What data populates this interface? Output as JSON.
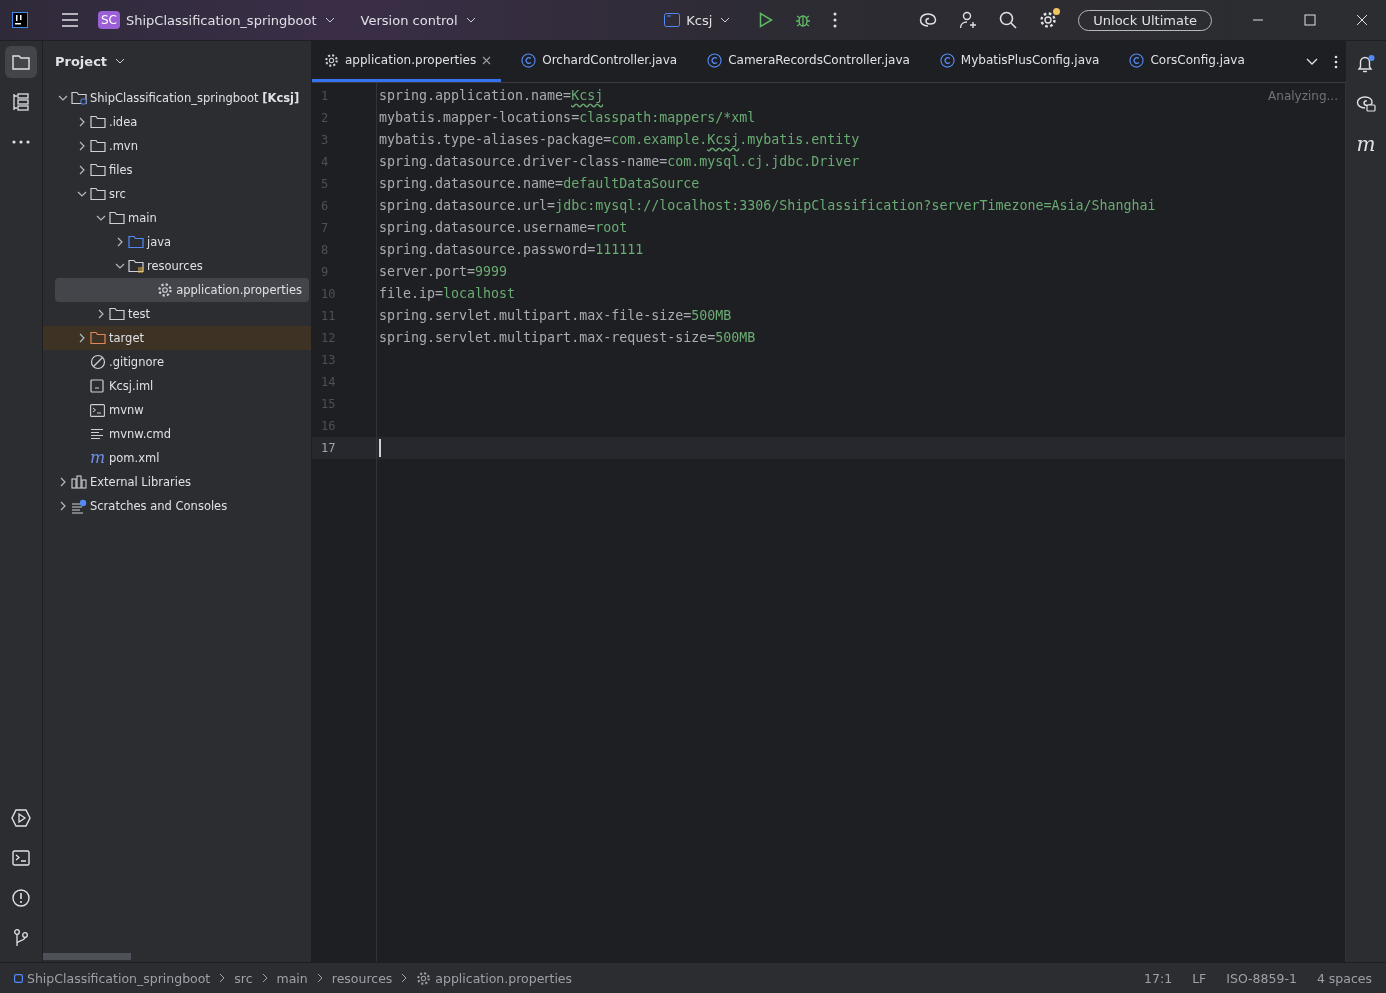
{
  "title_bar": {
    "project_badge": "SC",
    "project_name": "ShipClassification_springboot",
    "vcs": "Version control",
    "run_config": "Kcsj",
    "settings_badge": true,
    "unlock_button": "Unlock Ultimate"
  },
  "left_toolbar": [
    {
      "kind": "project",
      "selected": true
    },
    {
      "kind": "structure",
      "selected": false
    },
    {
      "kind": "more",
      "selected": false
    }
  ],
  "left_toolbar_bottom": [
    {
      "kind": "services"
    },
    {
      "kind": "terminal"
    },
    {
      "kind": "problems"
    },
    {
      "kind": "git"
    }
  ],
  "project_panel": {
    "title": "Project",
    "tree": [
      {
        "kind": "module-root",
        "label": "ShipClassification_springboot **[Kcsj]**",
        "expanded": true,
        "selected": false,
        "children": [
          {
            "kind": "folder",
            "label": ".idea",
            "expanded": false,
            "selected": false
          },
          {
            "kind": "folder",
            "label": ".mvn",
            "expanded": false,
            "selected": false
          },
          {
            "kind": "folder",
            "label": "files",
            "expanded": false,
            "selected": false
          },
          {
            "kind": "folder",
            "label": "src",
            "expanded": true,
            "selected": false,
            "children": [
              {
                "kind": "folder",
                "label": "main",
                "expanded": true,
                "selected": false,
                "children": [
                  {
                    "kind": "source-folder",
                    "label": "java",
                    "expanded": false,
                    "selected": false
                  },
                  {
                    "kind": "resources-folder",
                    "label": "resources",
                    "expanded": true,
                    "selected": false,
                    "children": [
                      {
                        "kind": "settings",
                        "label": "application.properties",
                        "selected": true
                      }
                    ]
                  }
                ]
              },
              {
                "kind": "folder",
                "label": "test",
                "expanded": false,
                "selected": false
              }
            ]
          },
          {
            "kind": "excluded-folder",
            "label": "target",
            "expanded": false,
            "selected": false
          },
          {
            "kind": "ignore",
            "label": ".gitignore",
            "selected": false
          },
          {
            "kind": "module-file",
            "label": "Kcsj.iml",
            "selected": false
          },
          {
            "kind": "script",
            "label": "mvnw",
            "selected": false
          },
          {
            "kind": "text",
            "label": "mvnw.cmd",
            "selected": false
          },
          {
            "kind": "maven",
            "glyph": "m",
            "label": "pom.xml",
            "selected": false
          }
        ]
      },
      {
        "kind": "libraries",
        "label": "External Libraries",
        "expanded": false,
        "selected": false
      },
      {
        "kind": "scratches",
        "label": "Scratches and Consoles",
        "expanded": false,
        "selected": false
      }
    ]
  },
  "tabs": [
    {
      "kind": "settings",
      "label": "application.properties",
      "selected": true
    },
    {
      "kind": "class",
      "label": "OrchardController.java",
      "selected": false
    },
    {
      "kind": "class",
      "label": "CameraRecordsController.java",
      "selected": false
    },
    {
      "kind": "class",
      "label": "MybatisPlusConfig.java",
      "selected": false
    },
    {
      "kind": "class",
      "label": "CorsConfig.java",
      "selected": false
    }
  ],
  "editor": {
    "status": "Analyzing...",
    "lines": [
      {
        "number": "1",
        "key": "spring.application.name=",
        "value": [
          {
            "text": "Kcsj",
            "typo": true
          }
        ],
        "current": false
      },
      {
        "number": "2",
        "key": "mybatis.mapper-locations=",
        "value": [
          {
            "text": "classpath:mappers/*xml",
            "typo": false
          }
        ],
        "current": false
      },
      {
        "number": "3",
        "key": "mybatis.type-aliases-package=",
        "value": [
          {
            "text": "com.example.",
            "typo": false
          },
          {
            "text": "Kcsj",
            "typo": true
          },
          {
            "text": ".mybatis.entity",
            "typo": false
          }
        ],
        "current": false
      },
      {
        "number": "4",
        "key": "spring.datasource.driver-class-name=",
        "value": [
          {
            "text": "com.mysql.cj.jdbc.Driver",
            "typo": false
          }
        ],
        "current": false
      },
      {
        "number": "5",
        "key": "spring.datasource.name=",
        "value": [
          {
            "text": "defaultDataSource",
            "typo": false
          }
        ],
        "current": false
      },
      {
        "number": "6",
        "key": "spring.datasource.url=",
        "value": [
          {
            "text": "jdbc:mysql://localhost:3306/ShipClassification?serverTimezone=Asia/Shanghai",
            "typo": false
          }
        ],
        "current": false
      },
      {
        "number": "7",
        "key": "spring.datasource.username=",
        "value": [
          {
            "text": "root",
            "typo": false
          }
        ],
        "current": false
      },
      {
        "number": "8",
        "key": "spring.datasource.password=",
        "value": [
          {
            "text": "111111",
            "typo": false
          }
        ],
        "current": false
      },
      {
        "number": "9",
        "key": "server.port=",
        "value": [
          {
            "text": "9999",
            "typo": false
          }
        ],
        "current": false
      },
      {
        "number": "10",
        "key": "file.ip=",
        "value": [
          {
            "text": "localhost",
            "typo": false
          }
        ],
        "current": false
      },
      {
        "number": "11",
        "key": "spring.servlet.multipart.max-file-size=",
        "value": [
          {
            "text": "500MB",
            "typo": false
          }
        ],
        "current": false
      },
      {
        "number": "12",
        "key": "spring.servlet.multipart.max-request-size=",
        "value": [
          {
            "text": "500MB",
            "typo": false
          }
        ],
        "current": false
      },
      {
        "number": "13",
        "current": false
      },
      {
        "number": "14",
        "current": false
      },
      {
        "number": "15",
        "current": false
      },
      {
        "number": "16",
        "current": false
      },
      {
        "number": "17",
        "current": true
      }
    ]
  },
  "right_toolbar": [
    {
      "kind": "notifications",
      "badge": true
    },
    {
      "kind": "ai-chat"
    },
    {
      "kind": "maven",
      "glyph": "m"
    }
  ],
  "status_bar": {
    "breadcrumbs": [
      {
        "kind": "module",
        "label": "ShipClassification_springboot"
      },
      {
        "kind": "folder",
        "label": "src"
      },
      {
        "kind": "folder",
        "label": "main"
      },
      {
        "kind": "folder",
        "label": "resources"
      },
      {
        "kind": "settings",
        "label": "application.properties"
      }
    ],
    "items": [
      "17:1",
      "LF",
      "ISO-8859-1",
      "4 spaces"
    ]
  }
}
